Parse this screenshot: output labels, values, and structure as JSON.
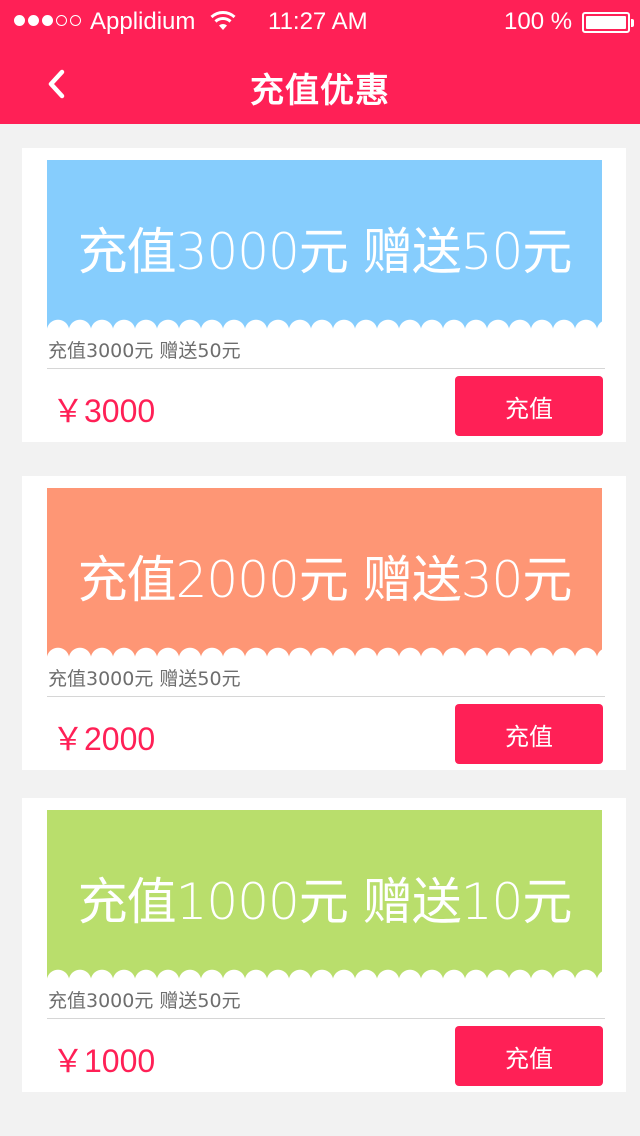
{
  "status_bar": {
    "carrier": "Applidium",
    "time": "11:27  AM",
    "battery": "100  %"
  },
  "nav": {
    "title": "充值优惠",
    "back_icon": "chevron-left-icon"
  },
  "offers": [
    {
      "banner_text": "充值3000元  赠送50元",
      "subtitle": "充值3000元  赠送50元",
      "price": "￥3000",
      "button_label": "充值",
      "color": "#86cdfd"
    },
    {
      "banner_text": "充值2000元  赠送30元",
      "subtitle": "充值3000元  赠送50元",
      "price": "￥2000",
      "button_label": "充值",
      "color": "#fe9675"
    },
    {
      "banner_text": "充值1000元  赠送10元",
      "subtitle": "充值3000元  赠送50元",
      "price": "￥1000",
      "button_label": "充值",
      "color": "#b9de6c"
    }
  ],
  "colors": {
    "brand": "#ff2056",
    "background": "#f2f2f2"
  }
}
